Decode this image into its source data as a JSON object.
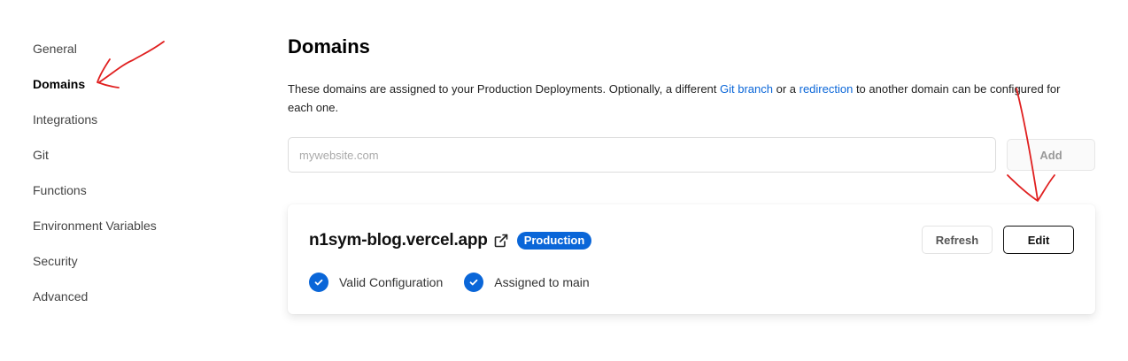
{
  "sidebar": {
    "items": [
      {
        "label": "General"
      },
      {
        "label": "Domains",
        "active": true
      },
      {
        "label": "Integrations"
      },
      {
        "label": "Git"
      },
      {
        "label": "Functions"
      },
      {
        "label": "Environment Variables"
      },
      {
        "label": "Security"
      },
      {
        "label": "Advanced"
      }
    ]
  },
  "main": {
    "title": "Domains",
    "description": {
      "part1": "These domains are assigned to your Production Deployments. Optionally, a different ",
      "link1": "Git branch",
      "part2": " or a ",
      "link2": "redirection",
      "part3": " to another domain can be configured for each one."
    },
    "add_form": {
      "placeholder": "mywebsite.com",
      "value": "",
      "add_label": "Add"
    },
    "domain_card": {
      "domain": "n1sym-blog.vercel.app",
      "badge": "Production",
      "refresh_label": "Refresh",
      "edit_label": "Edit",
      "statuses": [
        {
          "label": "Valid Configuration",
          "icon": "check-circle-icon"
        },
        {
          "label": "Assigned to main",
          "icon": "check-circle-icon"
        }
      ]
    }
  },
  "colors": {
    "accent": "#0a66d8",
    "annotation": "#e02020"
  }
}
